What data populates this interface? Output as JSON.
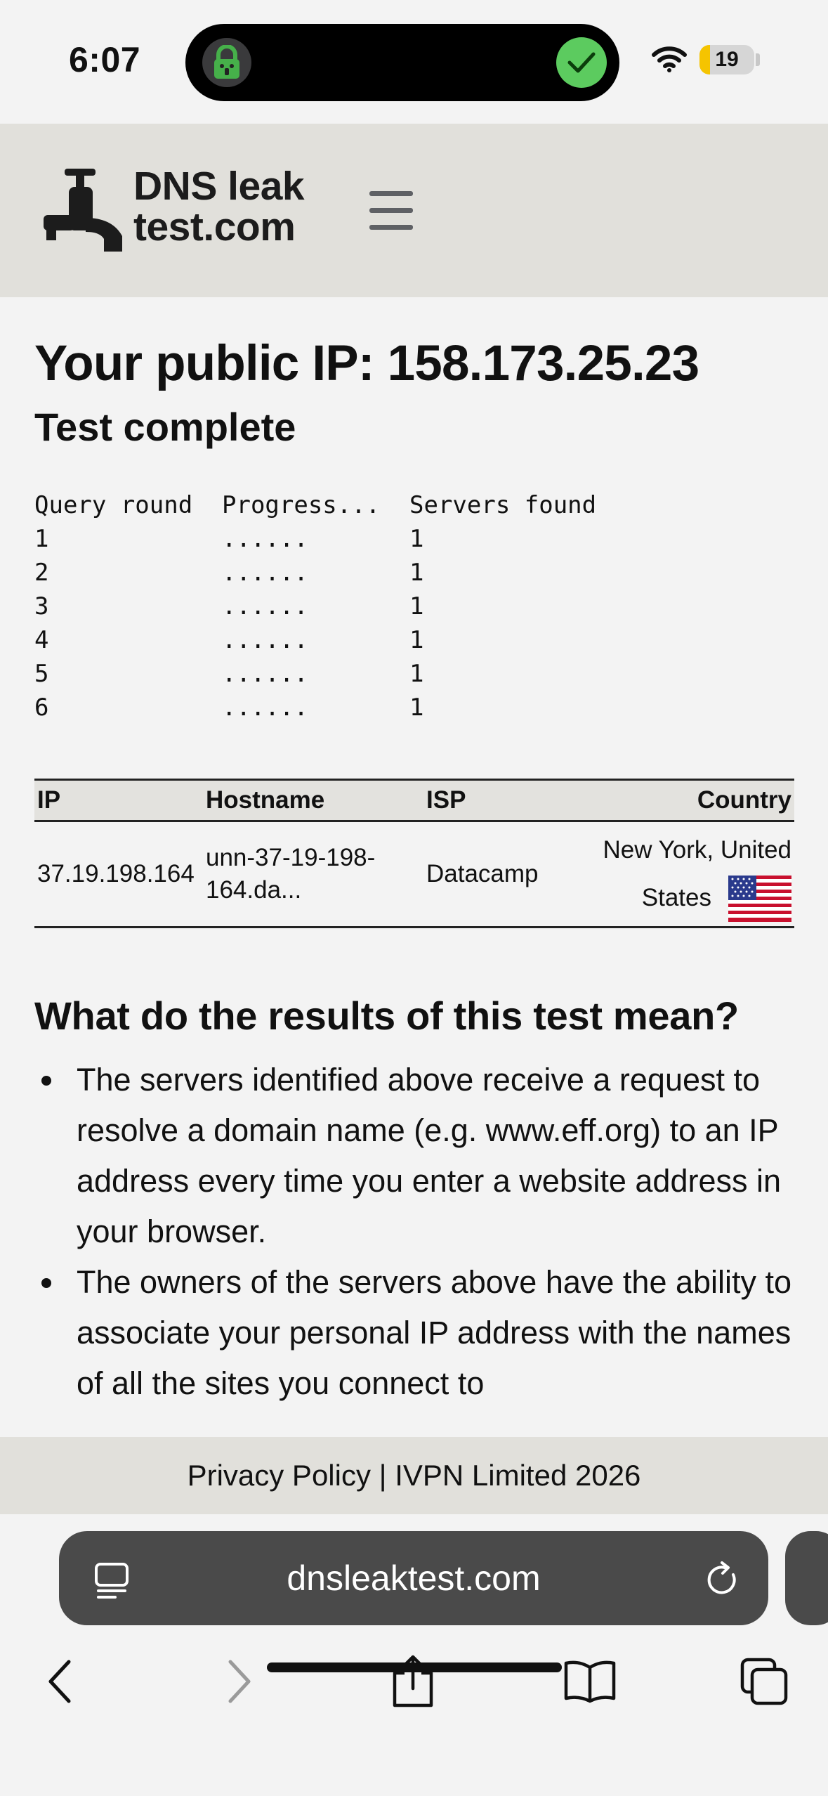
{
  "status_bar": {
    "time": "6:07",
    "battery": "19",
    "battery_fraction": 0.19
  },
  "header": {
    "logo_line1": "DNS leak",
    "logo_line2": "test.com",
    "menu_icon": "hamburger-menu-icon"
  },
  "main": {
    "headline": "Your public IP: 158.173.25.23",
    "status": "Test complete",
    "progress": {
      "headers": [
        "Query round",
        "Progress...",
        "Servers found"
      ],
      "rows": [
        {
          "round": "1",
          "progress": "......",
          "found": "1"
        },
        {
          "round": "2",
          "progress": "......",
          "found": "1"
        },
        {
          "round": "3",
          "progress": "......",
          "found": "1"
        },
        {
          "round": "4",
          "progress": "......",
          "found": "1"
        },
        {
          "round": "5",
          "progress": "......",
          "found": "1"
        },
        {
          "round": "6",
          "progress": "......",
          "found": "1"
        }
      ]
    },
    "results_table": {
      "headers": {
        "ip": "IP",
        "hostname": "Hostname",
        "isp": "ISP",
        "country": "Country"
      },
      "rows": [
        {
          "ip": "37.19.198.164",
          "hostname": "unn-37-19-198-164.da...",
          "isp": "Datacamp",
          "country_line1": "New York, United",
          "country_line2": "States",
          "flag": "us-flag-icon"
        }
      ]
    },
    "explanation_heading": "What do the results of this test mean?",
    "bullets": [
      "The servers identified above receive a request to resolve a domain name (e.g. www.eff.org) to an IP address every time you enter a website address in your browser.",
      "The owners of the servers above have the ability to associate your personal IP address with the names of all the sites you connect to"
    ]
  },
  "footer": {
    "text": "Privacy Policy | IVPN Limited 2026"
  },
  "browser": {
    "url": "dnsleaktest.com"
  },
  "colors": {
    "header_bg": "#e1e0db",
    "url_bar_bg": "#4a4a4a",
    "check_green": "#5ccb5f",
    "battery_yellow": "#f5c400"
  }
}
